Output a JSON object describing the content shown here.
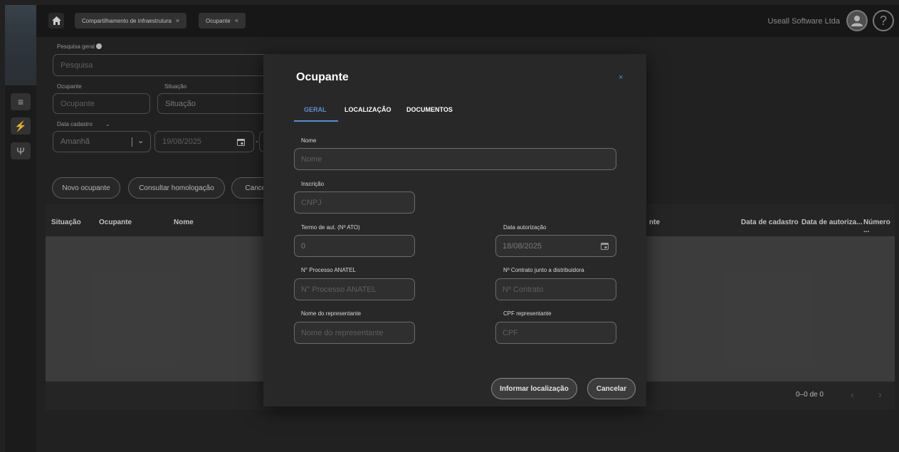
{
  "header": {
    "tabs": [
      {
        "label": "Compartilhamento de infraestrutura"
      },
      {
        "label": "Ocupante"
      }
    ],
    "close_glyph": "×",
    "user_name": "Useall Software Ltda",
    "help_glyph": "?"
  },
  "rail": {
    "items": [
      {
        "icon": "menu-icon",
        "glyph": "≡"
      },
      {
        "icon": "lightning-icon",
        "glyph": "⚡"
      },
      {
        "icon": "antenna-icon",
        "glyph": "Ψ"
      }
    ]
  },
  "filters": {
    "general_search_label": "Pesquisa geral",
    "general_search_placeholder": "Pesquisa",
    "occupant_label": "Ocupante",
    "occupant_placeholder": "Ocupante",
    "status_label": "Situação",
    "status_placeholder": "Situação",
    "date_label": "Data cadastro",
    "date_preset": "Amanhã",
    "date_from": "19/08/2025",
    "date_sep": "-"
  },
  "actions": {
    "new_label": "Novo ocupante",
    "consult_label": "Consultar homologação",
    "cancel_label": "Cancel"
  },
  "table": {
    "columns": [
      "Situação",
      "Ocupante",
      "Nome",
      "nte",
      "Data de cadastro",
      "Data de autoriza...",
      "Número ..."
    ],
    "pagination": "0–0 de 0",
    "prev_glyph": "‹",
    "next_glyph": "›"
  },
  "modal": {
    "title": "Ocupante",
    "close_glyph": "×",
    "tabs": [
      "GERAL",
      "LOCALIZAÇÃO",
      "DOCUMENTOS"
    ],
    "fields": {
      "name_label": "Nome",
      "name_placeholder": "Nome",
      "registration_label": "Inscrição",
      "registration_placeholder": "CNPJ",
      "term_label": "Termo de aut. (Nº ATO)",
      "term_value": "0",
      "auth_date_label": "Data autorização",
      "auth_date_value": "18/08/2025",
      "anatel_label": "N° Processo ANATEL",
      "anatel_placeholder": "N° Processo ANATEL",
      "contract_label": "Nº Contrato junto a distribuidora",
      "contract_placeholder": "Nº Contrato",
      "rep_name_label": "Nome do representante",
      "rep_name_placeholder": "Nome do representante",
      "rep_cpf_label": "CPF representante",
      "rep_cpf_placeholder": "CPF"
    },
    "buttons": {
      "locate_label": "Informar localização",
      "cancel_label": "Cancelar"
    }
  },
  "colors": {
    "accent": "#5b8ed6",
    "background": "#262626",
    "modal": "#282828"
  }
}
